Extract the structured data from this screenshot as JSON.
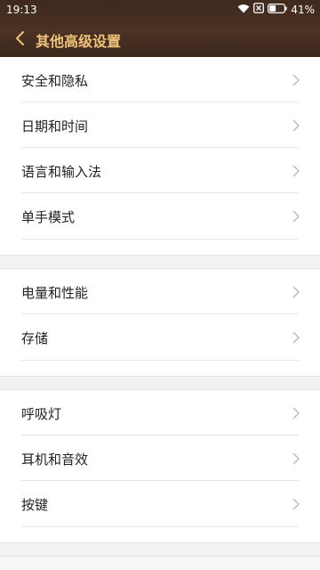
{
  "status_bar": {
    "time": "19:13",
    "battery_percent": "41%",
    "icons": [
      "wifi-icon",
      "no-sim-icon",
      "battery-icon"
    ]
  },
  "header": {
    "title": "其他高级设置",
    "back_icon": "chevron-left-icon"
  },
  "colors": {
    "header_bg": "#45301f",
    "title_color": "#f1c27a",
    "list_bg": "#ffffff",
    "page_bg": "#f7f7f7"
  },
  "groups": [
    {
      "items": [
        {
          "label": "安全和隐私"
        },
        {
          "label": "日期和时间"
        },
        {
          "label": "语言和输入法"
        },
        {
          "label": "单手模式"
        }
      ]
    },
    {
      "items": [
        {
          "label": "电量和性能"
        },
        {
          "label": "存储"
        }
      ]
    },
    {
      "items": [
        {
          "label": "呼吸灯"
        },
        {
          "label": "耳机和音效"
        },
        {
          "label": "按键"
        }
      ]
    }
  ]
}
